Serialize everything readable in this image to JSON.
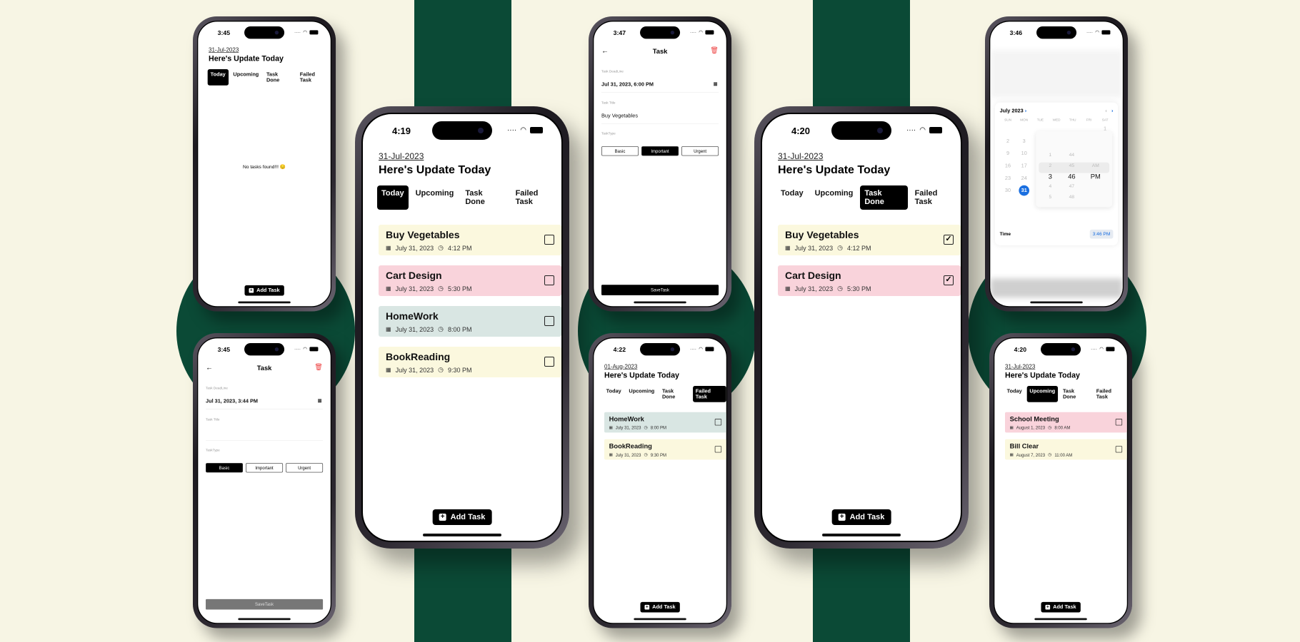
{
  "colors": {
    "background": "#f7f5e4",
    "accent_green": "#0b4a36",
    "card_yellow": "#fbf8de",
    "card_pink": "#f9d3db",
    "card_teal": "#d9e6e3",
    "calendar_blue": "#1a6fe0",
    "delete_red": "#e44444"
  },
  "common": {
    "heading": "Here's Update Today",
    "tabs": [
      "Today",
      "Upcoming",
      "Task Done",
      "Failed Task"
    ],
    "add_task": "Add Task",
    "form_title": "Task",
    "deadline_label": "Task DeadLine",
    "title_label": "Task Title",
    "type_label": "TaskType",
    "types": [
      "Basic",
      "Important",
      "Urgent"
    ],
    "save": "SaveTask"
  },
  "phones": [
    {
      "id": "p1",
      "kind": "list",
      "time": "3:45",
      "date": "31-Jul-2023",
      "active_tab": 0,
      "empty_text": "No tasks found!!! 😔",
      "tasks": []
    },
    {
      "id": "p2",
      "kind": "form",
      "time": "3:45",
      "deadline": "Jul 31, 2023, 3:44 PM",
      "task_title": "",
      "active_type": 0,
      "save_disabled": true
    },
    {
      "id": "p3",
      "kind": "list",
      "time": "4:19",
      "date": "31-Jul-2023",
      "active_tab": 0,
      "tasks": [
        {
          "title": "Buy Vegetables",
          "date": "July 31, 2023",
          "time": "4:12 PM",
          "color": "yellow",
          "done": false
        },
        {
          "title": "Cart Design",
          "date": "July 31, 2023",
          "time": "5:30 PM",
          "color": "pink",
          "done": false
        },
        {
          "title": "HomeWork",
          "date": "July 31, 2023",
          "time": "8:00 PM",
          "color": "teal",
          "done": false
        },
        {
          "title": "BookReading",
          "date": "July 31, 2023",
          "time": "9:30 PM",
          "color": "yellow",
          "done": false
        }
      ]
    },
    {
      "id": "p4",
      "kind": "form",
      "time": "3:47",
      "deadline": "Jul 31, 2023, 6:00 PM",
      "task_title": "Buy Vegetables",
      "active_type": 1,
      "save_disabled": false
    },
    {
      "id": "p5",
      "kind": "list",
      "time": "4:22",
      "date": "01-Aug-2023",
      "active_tab": 3,
      "tasks": [
        {
          "title": "HomeWork",
          "date": "July 31, 2023",
          "time": "8:00 PM",
          "color": "teal",
          "done": false
        },
        {
          "title": "BookReading",
          "date": "July 31, 2023",
          "time": "9:30 PM",
          "color": "yellow",
          "done": false
        }
      ]
    },
    {
      "id": "p6",
      "kind": "list",
      "time": "4:20",
      "date": "31-Jul-2023",
      "active_tab": 2,
      "tasks": [
        {
          "title": "Buy Vegetables",
          "date": "July 31, 2023",
          "time": "4:12 PM",
          "color": "yellow",
          "done": true
        },
        {
          "title": "Cart Design",
          "date": "July 31, 2023",
          "time": "5:30 PM",
          "color": "pink",
          "done": true
        }
      ]
    },
    {
      "id": "p7",
      "kind": "calendar",
      "time": "3:46",
      "month": "July 2023",
      "weekdays": [
        "SUN",
        "MON",
        "TUE",
        "WED",
        "THU",
        "FRI",
        "SAT"
      ],
      "days": [
        [
          "",
          "",
          "",
          "",
          "",
          "",
          "1"
        ],
        [
          "2",
          "3",
          "",
          "",
          "",
          "",
          ""
        ],
        [
          "9",
          "10",
          "",
          "",
          "",
          "",
          ""
        ],
        [
          "16",
          "17",
          "",
          "",
          "",
          "",
          ""
        ],
        [
          "23",
          "24",
          "",
          "",
          "",
          "",
          ""
        ],
        [
          "30",
          "31",
          "",
          "",
          "",
          "",
          ""
        ]
      ],
      "selected_day": "31",
      "picker": {
        "hours": [
          "1",
          "2",
          "3",
          "4",
          "5"
        ],
        "minutes": [
          "44",
          "45",
          "46",
          "47",
          "48"
        ],
        "period": [
          "AM",
          "PM"
        ],
        "selected": [
          "3",
          "46",
          "PM"
        ]
      },
      "time_label": "Time",
      "time_value": "3:46 PM"
    },
    {
      "id": "p8",
      "kind": "list",
      "time": "4:20",
      "date": "31-Jul-2023",
      "active_tab": 1,
      "tasks": [
        {
          "title": "School Meeting",
          "date": "August 1, 2023",
          "time": "8:00 AM",
          "color": "pink",
          "done": false
        },
        {
          "title": "Bill Clear",
          "date": "August 7, 2023",
          "time": "11:00 AM",
          "color": "yellow",
          "done": false
        }
      ]
    }
  ]
}
